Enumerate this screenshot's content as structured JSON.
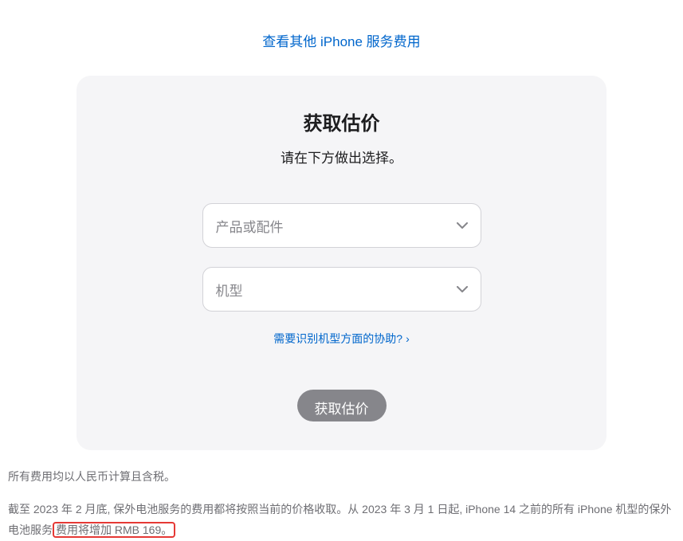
{
  "topLink": {
    "label": "查看其他 iPhone 服务费用"
  },
  "card": {
    "title": "获取估价",
    "subtitle": "请在下方做出选择。",
    "select1Placeholder": "产品或配件",
    "select2Placeholder": "机型",
    "helpLabel": "需要识别机型方面的协助?",
    "helpArrow": "›",
    "submitLabel": "获取估价"
  },
  "footer": {
    "line1": "所有费用均以人民币计算且含税。",
    "line2a": "截至 2023 年 2 月底, 保外电池服务的费用都将按照当前的价格收取。从 2023 年 3 月 1 日起, iPhone 14 之前的所有 iPhone 机型的保外电池服务",
    "highlightText": "费用将增加 RMB 169。"
  }
}
